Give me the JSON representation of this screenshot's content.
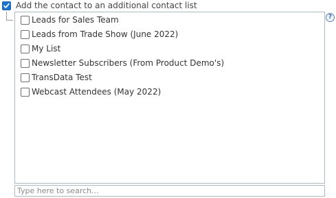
{
  "main_option": {
    "label": "Add the contact to an additional contact list",
    "checked": true
  },
  "contact_lists": [
    {
      "label": "Leads for Sales Team",
      "checked": false
    },
    {
      "label": "Leads from Trade Show (June 2022)",
      "checked": false
    },
    {
      "label": "My List",
      "checked": false
    },
    {
      "label": "Newsletter Subscribers (From Product Demo's)",
      "checked": false
    },
    {
      "label": "TransData Test",
      "checked": false
    },
    {
      "label": "Webcast Attendees (May 2022)",
      "checked": false
    }
  ],
  "help": {
    "glyph": "?",
    "icon": "help-icon"
  },
  "search": {
    "placeholder": "Type here to search...",
    "value": ""
  },
  "colors": {
    "accent": "#1a73d4",
    "border": "#a9b8c8",
    "text": "#333333"
  }
}
